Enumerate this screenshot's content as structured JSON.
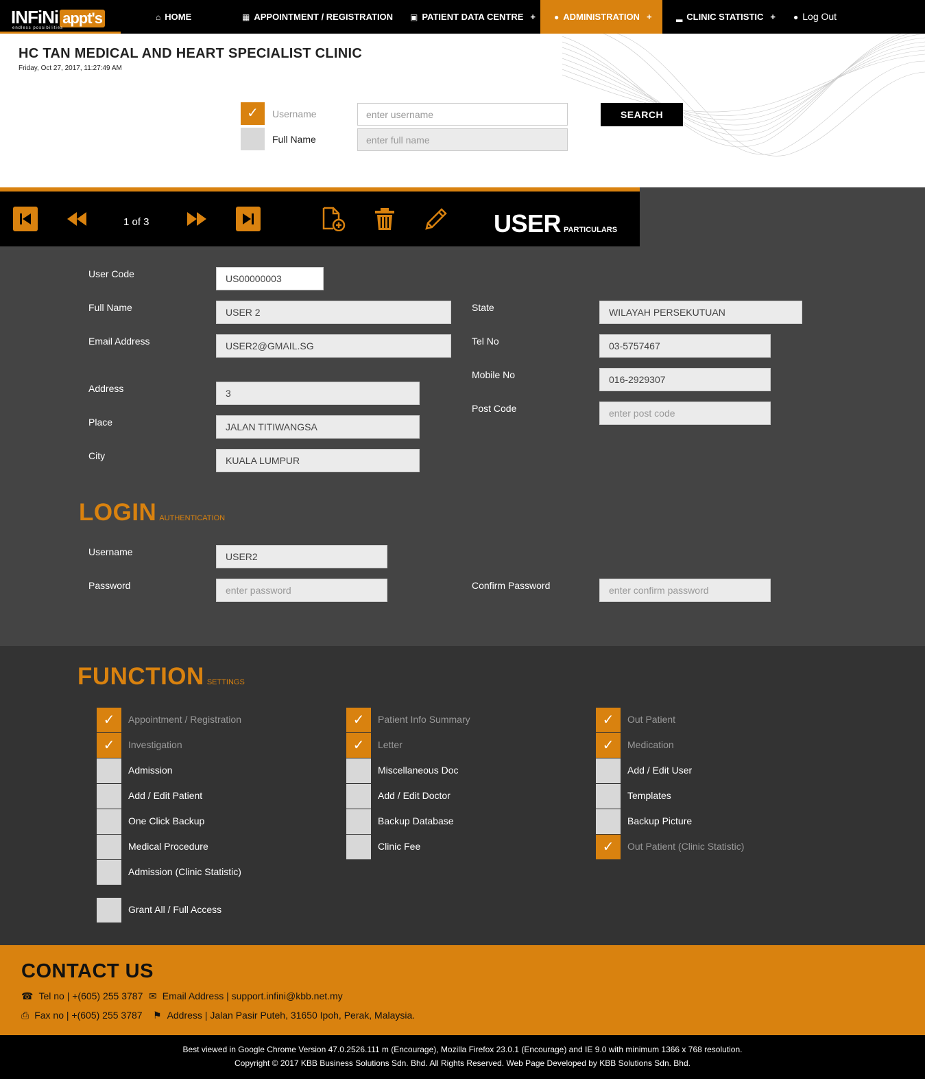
{
  "nav": {
    "logo_main": "INFiNi",
    "logo_appts": "appt's",
    "logo_tag": "endless possibilities",
    "items": [
      {
        "label": "HOME",
        "icon": "home-icon"
      },
      {
        "label": "APPOINTMENT / REGISTRATION",
        "icon": "calendar-icon"
      },
      {
        "label": "PATIENT DATA CENTRE",
        "icon": "document-icon",
        "plus": "+"
      },
      {
        "label": "ADMINISTRATION",
        "icon": "user-icon",
        "plus": "+",
        "active": true
      },
      {
        "label": "CLINIC STATISTIC",
        "icon": "bar-chart-icon",
        "plus": "+"
      },
      {
        "label": "Log Out",
        "icon": "user-icon"
      }
    ]
  },
  "header": {
    "clinic_name": "HC TAN MEDICAL AND HEART SPECIALIST CLINIC",
    "datetime": "Friday, Oct 27, 2017, 11:27:49 AM"
  },
  "search": {
    "username_label": "Username",
    "username_placeholder": "enter username",
    "username_checked": true,
    "fullname_label": "Full Name",
    "fullname_placeholder": "enter full name",
    "fullname_checked": false,
    "button": "SEARCH"
  },
  "toolbar": {
    "page_indicator": "1 of 3",
    "title": "USER",
    "subtitle": "PARTICULARS"
  },
  "user": {
    "user_code_label": "User Code",
    "user_code": "US00000003",
    "full_name_label": "Full Name",
    "full_name": "USER 2",
    "email_label": "Email Address",
    "email": "USER2@GMAIL.SG",
    "address_label": "Address",
    "address": "3",
    "place_label": "Place",
    "place": "JALAN TITIWANGSA",
    "city_label": "City",
    "city": "KUALA LUMPUR",
    "state_label": "State",
    "state": "WILAYAH PERSEKUTUAN",
    "tel_label": "Tel No",
    "tel": "03-5757467",
    "mobile_label": "Mobile No",
    "mobile": "016-2929307",
    "postcode_label": "Post Code",
    "postcode_placeholder": "enter post code"
  },
  "login": {
    "title": "LOGIN",
    "subtitle": "AUTHENTICATION",
    "username_label": "Username",
    "username": "USER2",
    "password_label": "Password",
    "password_placeholder": "enter password",
    "confirm_label": "Confirm Password",
    "confirm_placeholder": "enter confirm password"
  },
  "function": {
    "title": "FUNCTION",
    "subtitle": "SETTINGS",
    "items": [
      {
        "label": "Appointment / Registration",
        "checked": true
      },
      {
        "label": "Patient Info Summary",
        "checked": true
      },
      {
        "label": "Out Patient",
        "checked": true
      },
      {
        "label": "Investigation",
        "checked": true
      },
      {
        "label": "Letter",
        "checked": true
      },
      {
        "label": "Medication",
        "checked": true
      },
      {
        "label": "Admission",
        "checked": false
      },
      {
        "label": "Miscellaneous Doc",
        "checked": false
      },
      {
        "label": "Add / Edit User",
        "checked": false
      },
      {
        "label": "Add / Edit Patient",
        "checked": false
      },
      {
        "label": "Add / Edit Doctor",
        "checked": false
      },
      {
        "label": "Templates",
        "checked": false
      },
      {
        "label": "One Click Backup",
        "checked": false
      },
      {
        "label": "Backup Database",
        "checked": false
      },
      {
        "label": "Backup Picture",
        "checked": false
      },
      {
        "label": "Medical Procedure",
        "checked": false
      },
      {
        "label": "Clinic Fee",
        "checked": false
      },
      {
        "label": "Out Patient (Clinic Statistic)",
        "checked": true
      },
      {
        "label": "Admission (Clinic Statistic)",
        "checked": false
      }
    ],
    "grant_all": {
      "label": "Grant All / Full Access",
      "checked": false
    }
  },
  "contact": {
    "title": "CONTACT US",
    "tel": "Tel no | +(605) 255 3787",
    "email": "Email Address | support.infini@kbb.net.my",
    "fax": "Fax no | +(605) 255 3787",
    "address": "Address | Jalan Pasir Puteh, 31650 Ipoh, Perak, Malaysia."
  },
  "footer": {
    "line1": "Best viewed in Google Chrome Version 47.0.2526.111 m (Encourage), Mozilla Firefox 23.0.1 (Encourage) and IE 9.0 with minimum 1366 x 768 resolution.",
    "line2": "Copyright © 2017 KBB Business Solutions Sdn. Bhd. All Rights Reserved. Web Page Developed by KBB Solutions Sdn. Bhd."
  },
  "colors": {
    "accent": "#d9820f",
    "dark": "#000000",
    "panel": "#444444",
    "panel_dark": "#333333"
  }
}
